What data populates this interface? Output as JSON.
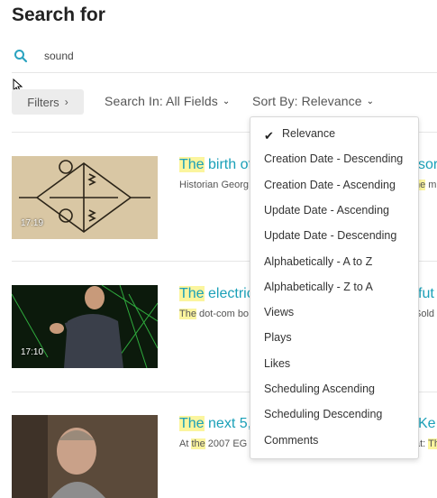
{
  "page_title": "Search for",
  "search": {
    "value": "sound"
  },
  "toolbar": {
    "filters_label": "Filters",
    "search_in_label": "Search In: All Fields",
    "sort_by_label": "Sort By: Relevance"
  },
  "results": [
    {
      "title_hl": "The",
      "title_rest": " birth of",
      "title_tail": "sor",
      "desc_start": "Historian Georg",
      "desc_tail_hl": "he",
      "desc_tail": " m",
      "duration": "17:19"
    },
    {
      "title_hl": "The",
      "title_rest": " electric",
      "title_tail": "fut",
      "desc_hl": "The",
      "desc_rest": " dot-com bo",
      "desc_tail": "Sold I",
      "duration": "17:10"
    },
    {
      "title_hl": "The",
      "title_rest": " next 5,0",
      "title_tail": "Ke",
      "desc_start": "At ",
      "desc_hl1": "the",
      "desc_rest": " 2007 EG",
      "desc_tail": "at: ",
      "desc_tail_hl": "Th"
    }
  ],
  "sort_menu": {
    "selected_index": 0,
    "options": [
      "Relevance",
      "Creation Date - Descending",
      "Creation Date - Ascending",
      "Update Date - Ascending",
      "Update Date - Descending",
      "Alphabetically - A to Z",
      "Alphabetically - Z to A",
      "Views",
      "Plays",
      "Likes",
      "Scheduling Ascending",
      "Scheduling Descending",
      "Comments"
    ]
  }
}
